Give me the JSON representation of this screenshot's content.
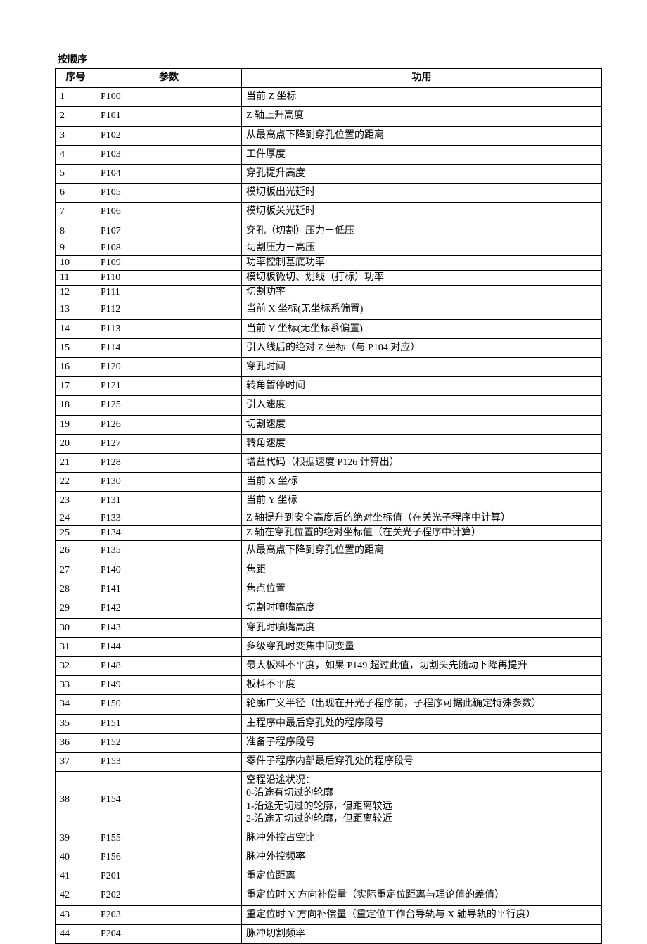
{
  "title": "按顺序",
  "headers": {
    "seq": "序号",
    "param": "参数",
    "func": "功用"
  },
  "rows": [
    {
      "seq": "1",
      "param": "P100",
      "func": "当前 Z 坐标",
      "cls": ""
    },
    {
      "seq": "2",
      "param": "P101",
      "func": "Z 轴上升高度",
      "cls": ""
    },
    {
      "seq": "3",
      "param": "P102",
      "func": "从最高点下降到穿孔位置的距离",
      "cls": ""
    },
    {
      "seq": "4",
      "param": "P103",
      "func": "工件厚度",
      "cls": ""
    },
    {
      "seq": "5",
      "param": "P104",
      "func": "穿孔提升高度",
      "cls": ""
    },
    {
      "seq": "6",
      "param": "P105",
      "func": "模切板出光延时",
      "cls": ""
    },
    {
      "seq": "7",
      "param": "P106",
      "func": "模切板关光延时",
      "cls": ""
    },
    {
      "seq": "8",
      "param": "P107",
      "func": "穿孔（切割）压力－低压",
      "cls": ""
    },
    {
      "seq": "9",
      "param": "P108",
      "func": "切割压力－高压",
      "cls": "tight"
    },
    {
      "seq": "10",
      "param": "P109",
      "func": "功率控制基底功率",
      "cls": "tight"
    },
    {
      "seq": "11",
      "param": "P110",
      "func": "模切板微切、划线（打标）功率",
      "cls": "tight"
    },
    {
      "seq": "12",
      "param": "P111",
      "func": "切割功率",
      "cls": "tight"
    },
    {
      "seq": "13",
      "param": "P112",
      "func": "当前 X 坐标(无坐标系偏置)",
      "cls": ""
    },
    {
      "seq": "14",
      "param": "P113",
      "func": "当前 Y 坐标(无坐标系偏置)",
      "cls": ""
    },
    {
      "seq": "15",
      "param": "P114",
      "func": "引入线后的绝对 Z 坐标（与 P104 对应）",
      "cls": ""
    },
    {
      "seq": "16",
      "param": "P120",
      "func": "穿孔时间",
      "cls": ""
    },
    {
      "seq": "17",
      "param": "P121",
      "func": "转角暂停时间",
      "cls": ""
    },
    {
      "seq": "18",
      "param": "P125",
      "func": "引入速度",
      "cls": ""
    },
    {
      "seq": "19",
      "param": "P126",
      "func": "切割速度",
      "cls": ""
    },
    {
      "seq": "20",
      "param": "P127",
      "func": "转角速度",
      "cls": ""
    },
    {
      "seq": "21",
      "param": "P128",
      "func": "增益代码（根据速度 P126 计算出）",
      "cls": ""
    },
    {
      "seq": "22",
      "param": "P130",
      "func": "当前 X 坐标",
      "cls": ""
    },
    {
      "seq": "23",
      "param": "P131",
      "func": "当前 Y 坐标",
      "cls": ""
    },
    {
      "seq": "24",
      "param": "P133",
      "func": "Z 轴提升到安全高度后的绝对坐标值（在关光子程序中计算）",
      "cls": "tight"
    },
    {
      "seq": "25",
      "param": "P134",
      "func": "Z 轴在穿孔位置的绝对坐标值（在关光子程序中计算）",
      "cls": "tight"
    },
    {
      "seq": "26",
      "param": "P135",
      "func": "从最高点下降到穿孔位置的距离",
      "cls": "roomy"
    },
    {
      "seq": "27",
      "param": "P140",
      "func": "焦距",
      "cls": ""
    },
    {
      "seq": "28",
      "param": "P141",
      "func": "焦点位置",
      "cls": ""
    },
    {
      "seq": "29",
      "param": "P142",
      "func": "切割时喷嘴高度",
      "cls": ""
    },
    {
      "seq": "30",
      "param": "P143",
      "func": "穿孔时喷嘴高度",
      "cls": ""
    },
    {
      "seq": "31",
      "param": "P144",
      "func": "多级穿孔时变焦中间变量",
      "cls": ""
    },
    {
      "seq": "32",
      "param": "P148",
      "func": "最大板料不平度，如果 P149 超过此值，切割头先随动下降再提升",
      "cls": ""
    },
    {
      "seq": "33",
      "param": "P149",
      "func": "板料不平度",
      "cls": ""
    },
    {
      "seq": "34",
      "param": "P150",
      "func": "轮廓广义半径（出现在开光子程序前，子程序可据此确定特殊参数）",
      "cls": ""
    },
    {
      "seq": "35",
      "param": "P151",
      "func": "主程序中最后穿孔处的程序段号",
      "cls": ""
    },
    {
      "seq": "36",
      "param": "P152",
      "func": "准备子程序段号",
      "cls": ""
    },
    {
      "seq": "37",
      "param": "P153",
      "func": "零件子程序内部最后穿孔处的程序段号",
      "cls": ""
    },
    {
      "seq": "38",
      "param": "P154",
      "func": "空程沿途状况：\n0-沿途有切过的轮廓\n1-沿途无切过的轮廓，但距离较远\n2-沿途无切过的轮廓，但距离较近",
      "cls": ""
    },
    {
      "seq": "39",
      "param": "P155",
      "func": "脉冲外控占空比",
      "cls": ""
    },
    {
      "seq": "40",
      "param": "P156",
      "func": "脉冲外控频率",
      "cls": ""
    },
    {
      "seq": "41",
      "param": "P201",
      "func": "重定位距离",
      "cls": ""
    },
    {
      "seq": "42",
      "param": "P202",
      "func": "重定位时 X 方向补偿量（实际重定位距离与理论值的差值）",
      "cls": ""
    },
    {
      "seq": "43",
      "param": "P203",
      "func": "重定位时 Y 方向补偿量（重定位工作台导轨与 X 轴导轨的平行度）",
      "cls": ""
    },
    {
      "seq": "44",
      "param": "P204",
      "func": "脉冲切割频率",
      "cls": ""
    }
  ]
}
